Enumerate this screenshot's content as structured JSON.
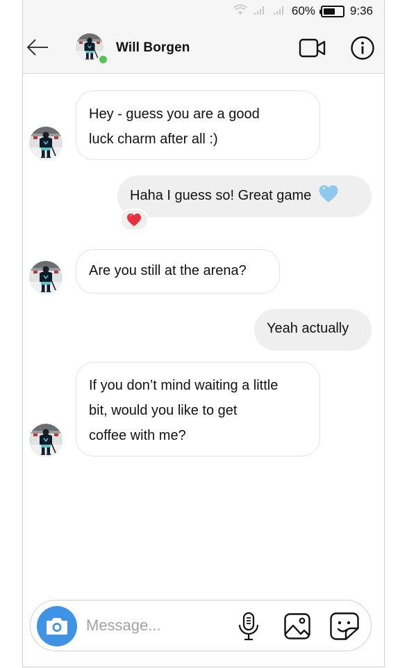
{
  "status_bar": {
    "battery": "60%",
    "battery_level": 0.6,
    "time": "9:36",
    "icons": [
      "wifi-icon",
      "signal-icon",
      "signal-icon",
      "battery-icon"
    ]
  },
  "header": {
    "contact_name": "Will Borgen",
    "online": true,
    "icons": [
      "back-arrow-icon",
      "avatar",
      "video-call-icon",
      "info-icon"
    ]
  },
  "messages": [
    {
      "from": "contact",
      "lines": [
        "Hey - guess you are a good",
        "luck charm after all :)"
      ]
    },
    {
      "from": "me",
      "text": "Haha I guess so! Great game",
      "emoji": "light-blue-heart",
      "reaction": "red-heart"
    },
    {
      "from": "contact",
      "lines": [
        "Are you still at the arena?"
      ]
    },
    {
      "from": "me",
      "text": "Yeah actually"
    },
    {
      "from": "contact",
      "lines": [
        "If you don’t mind waiting a little",
        "bit, would you like to get",
        "coffee with me?"
      ]
    }
  ],
  "composer": {
    "placeholder": "Message...",
    "value": "",
    "icons": [
      "camera-icon",
      "microphone-icon",
      "gallery-icon",
      "sticker-icon"
    ]
  },
  "colors": {
    "camera_button": "#3f93e6",
    "online_dot": "#52c65a",
    "outgoing_bubble": "#efefef",
    "heart_red": "#e8303c",
    "heart_blue": "#8ec9ee"
  }
}
